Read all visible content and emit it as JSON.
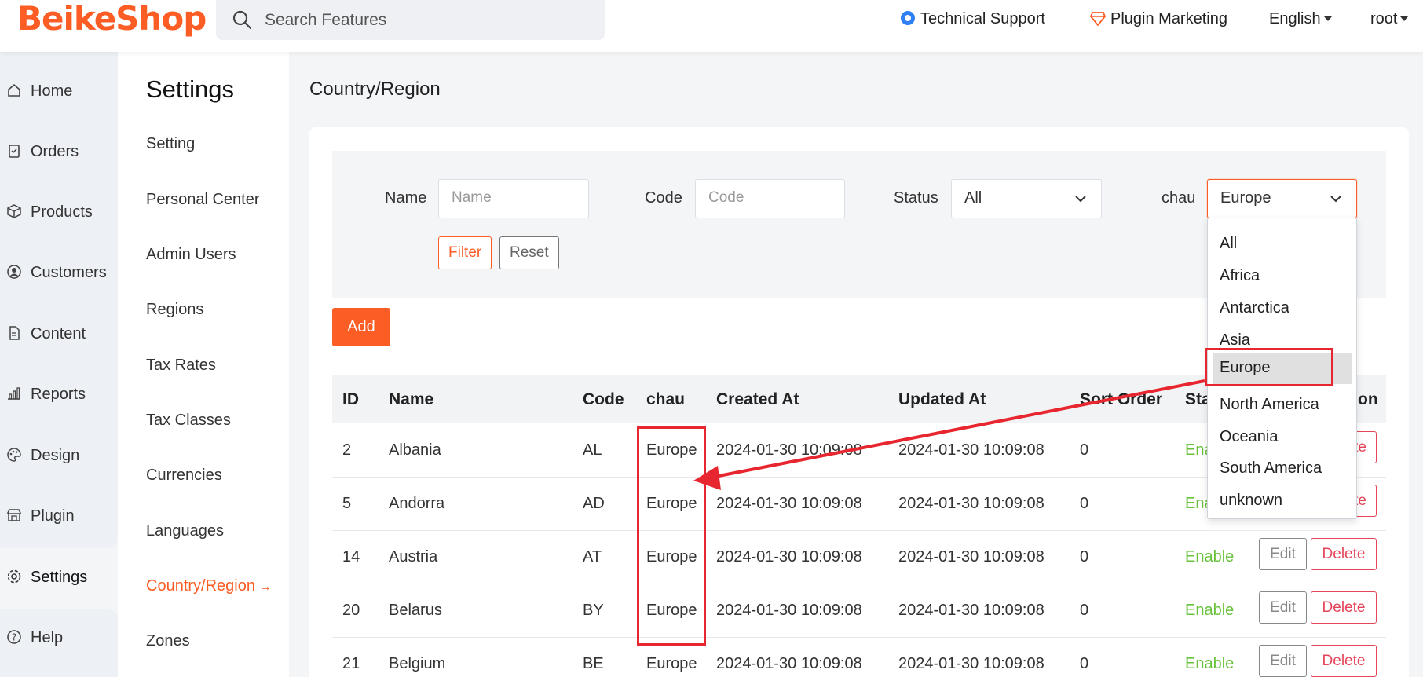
{
  "header": {
    "logo": "BeikeShop",
    "search_placeholder": "Search Features",
    "technical_support": "Technical Support",
    "plugin_marketing": "Plugin Marketing",
    "language": "English",
    "user": "root"
  },
  "nav": {
    "items": [
      "Home",
      "Orders",
      "Products",
      "Customers",
      "Content",
      "Reports",
      "Design",
      "Plugin",
      "Settings",
      "Help"
    ]
  },
  "subnav": {
    "title": "Settings",
    "items": [
      "Setting",
      "Personal Center",
      "Admin Users",
      "Regions",
      "Tax Rates",
      "Tax Classes",
      "Currencies",
      "Languages",
      "Country/Region",
      "Zones"
    ],
    "active_arrow": "→"
  },
  "page": {
    "title": "Country/Region"
  },
  "filter": {
    "name_label": "Name",
    "name_placeholder": "Name",
    "code_label": "Code",
    "code_placeholder": "Code",
    "status_label": "Status",
    "status_value": "All",
    "chau_label": "chau",
    "chau_value": "Europe",
    "filter_button": "Filter",
    "reset_button": "Reset"
  },
  "add_button": "Add",
  "table": {
    "headers": [
      "ID",
      "Name",
      "Code",
      "chau",
      "Created At",
      "Updated At",
      "Sort Order",
      "Sta",
      "on"
    ],
    "rows": [
      {
        "id": "2",
        "name": "Albania",
        "code": "AL",
        "chau": "Europe",
        "created": "2024-01-30 10:09:08",
        "updated": "2024-01-30 10:09:08",
        "sort": "0",
        "status": "Ena",
        "edit": "",
        "delete": "ete"
      },
      {
        "id": "5",
        "name": "Andorra",
        "code": "AD",
        "chau": "Europe",
        "created": "2024-01-30 10:09:08",
        "updated": "2024-01-30 10:09:08",
        "sort": "0",
        "status": "Ena",
        "edit": "",
        "delete": "ete"
      },
      {
        "id": "14",
        "name": "Austria",
        "code": "AT",
        "chau": "Europe",
        "created": "2024-01-30 10:09:08",
        "updated": "2024-01-30 10:09:08",
        "sort": "0",
        "status": "Enable",
        "edit": "Edit",
        "delete": "Delete"
      },
      {
        "id": "20",
        "name": "Belarus",
        "code": "BY",
        "chau": "Europe",
        "created": "2024-01-30 10:09:08",
        "updated": "2024-01-30 10:09:08",
        "sort": "0",
        "status": "Enable",
        "edit": "Edit",
        "delete": "Delete"
      },
      {
        "id": "21",
        "name": "Belgium",
        "code": "BE",
        "chau": "Europe",
        "created": "2024-01-30 10:09:08",
        "updated": "2024-01-30 10:09:08",
        "sort": "0",
        "status": "Enable",
        "edit": "Edit",
        "delete": "Delete"
      }
    ]
  },
  "dropdown": {
    "options": [
      "All",
      "Africa",
      "Antarctica",
      "Asia",
      "Europe",
      "North America",
      "Oceania",
      "South America",
      "unknown"
    ],
    "selected": "Europe"
  },
  "colors": {
    "brand": "#fb5d24",
    "enable": "#67c23a",
    "delete": "#e5455a",
    "annotation": "#e8262f"
  }
}
